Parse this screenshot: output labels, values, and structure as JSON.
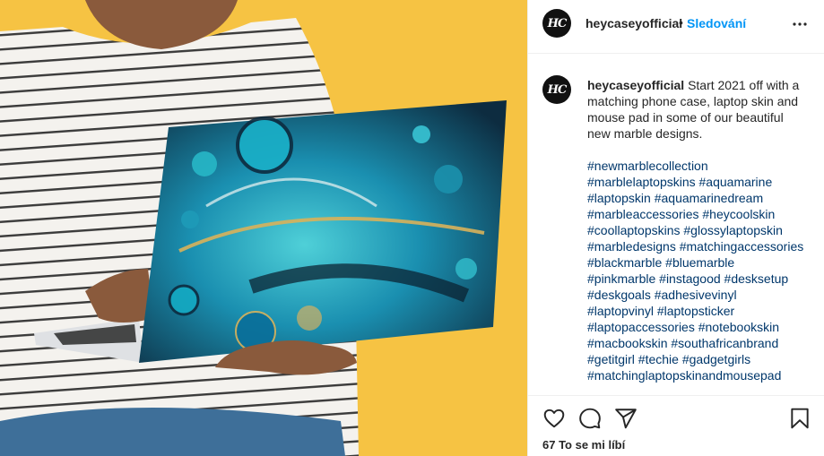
{
  "post": {
    "username": "heycaseyofficial",
    "avatar_initials": "HC",
    "separator": "•",
    "follow_label": "Sledování",
    "caption_text": "Start 2021 off with a matching phone case, laptop skin and mouse pad in some of our beautiful new marble designs.",
    "hashtags": [
      "#newmarblecollection",
      "#marblelaptopskins #aquamarine",
      "#laptopskin #aquamarinedream",
      "#marbleaccessories #heycoolskin",
      "#coollaptopskins #glossylaptopskin",
      "#marbledesigns #matchingaccessories",
      "#blackmarble #bluemarble",
      "#pinkmarble #instagood #desksetup",
      "#deskgoals #adhesivevinyl",
      "#laptopvinyl #laptopsticker",
      "#laptopaccessories #notebookskin",
      "#macbookskin #southafricanbrand",
      "#getitgirl #techie #gadgetgirls",
      "#matchinglaptopskinandmousepad"
    ],
    "likes": "67 To se mi líbí"
  },
  "colors": {
    "background_yellow": "#f6c343",
    "link_blue": "#0095f6",
    "hashtag_blue": "#00376b",
    "marble_teal": "#1fa3b8",
    "marble_dark": "#0f2a3c"
  },
  "icons": {
    "more": "ellipsis-icon",
    "like": "heart-icon",
    "comment": "comment-icon",
    "share": "send-icon",
    "save": "bookmark-icon"
  }
}
